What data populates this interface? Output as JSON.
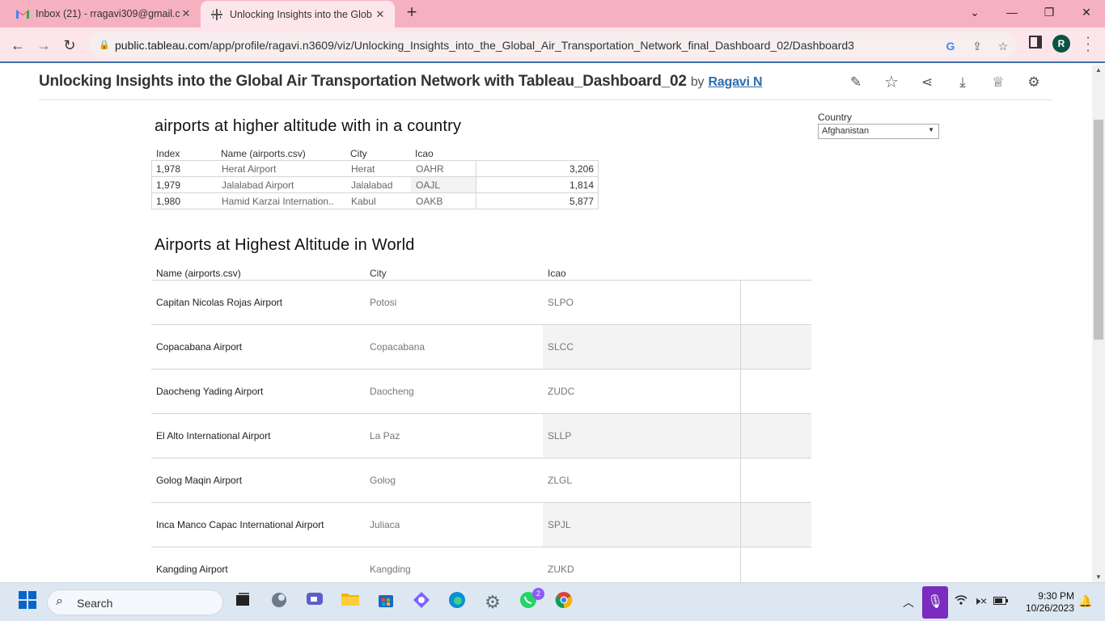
{
  "browser": {
    "tabs": [
      {
        "title": "Inbox (21) - rragavi309@gmail.c",
        "icon": "gmail-icon",
        "active": false
      },
      {
        "title": "Unlocking Insights into the Glob",
        "icon": "tableau-icon",
        "active": true
      }
    ],
    "url_host": "public.tableau.com",
    "url_path": "/app/profile/ragavi.n3609/viz/Unlocking_Insights_into_the_Global_Air_Transportation_Network_final_Dashboard_02/Dashboard3",
    "profile_initial": "R"
  },
  "viz": {
    "title": "Unlocking Insights into the Global Air Transportation Network with Tableau_Dashboard_02",
    "by": "by",
    "author": "Ragavi N"
  },
  "table1": {
    "title": "airports at higher altitude with in a country",
    "headers": [
      "Index",
      "Name (airports.csv)",
      "City",
      "Icao"
    ],
    "rows": [
      {
        "index": "1,978",
        "name": "Herat Airport",
        "city": "Herat",
        "icao": "OAHR",
        "value": "3,206"
      },
      {
        "index": "1,979",
        "name": "Jalalabad Airport",
        "city": "Jalalabad",
        "icao": "OAJL",
        "value": "1,814"
      },
      {
        "index": "1,980",
        "name": "Hamid Karzai Internation..",
        "city": "Kabul",
        "icao": "OAKB",
        "value": "5,877"
      }
    ]
  },
  "filter": {
    "label": "Country",
    "value": "Afghanistan"
  },
  "table2": {
    "title": "Airports at Highest Altitude in World",
    "headers": [
      "Name (airports.csv)",
      "City",
      "Icao"
    ],
    "rows": [
      {
        "name": "Capitan Nicolas Rojas Airport",
        "city": "Potosi",
        "icao": "SLPO"
      },
      {
        "name": "Copacabana Airport",
        "city": "Copacabana",
        "icao": "SLCC"
      },
      {
        "name": "Daocheng Yading Airport",
        "city": "Daocheng",
        "icao": "ZUDC"
      },
      {
        "name": "El Alto International Airport",
        "city": "La Paz",
        "icao": "SLLP"
      },
      {
        "name": "Golog Maqin Airport",
        "city": "Golog",
        "icao": "ZLGL"
      },
      {
        "name": "Inca Manco Capac International Airport",
        "city": "Juliaca",
        "icao": "SPJL"
      },
      {
        "name": "Kangding Airport",
        "city": "Kangding",
        "icao": "ZUKD"
      }
    ]
  },
  "taskbar": {
    "search_placeholder": "Search",
    "whatsapp_badge": "2",
    "time": "9:30 PM",
    "date": "10/26/2023"
  }
}
